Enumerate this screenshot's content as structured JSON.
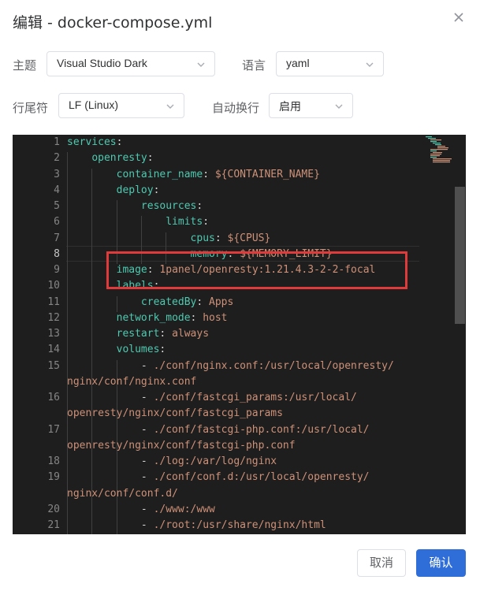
{
  "dialog": {
    "title": "编辑 - docker-compose.yml"
  },
  "form": {
    "theme_label": "主题",
    "theme_value": "Visual Studio Dark",
    "language_label": "语言",
    "language_value": "yaml",
    "eol_label": "行尾符",
    "eol_value": "LF (Linux)",
    "wrap_label": "自动换行",
    "wrap_value": "启用"
  },
  "editor": {
    "current_line": 8,
    "lines": [
      {
        "n": "1",
        "segments": [
          {
            "t": "services",
            "c": "k"
          },
          {
            "t": ":",
            "c": "p"
          }
        ]
      },
      {
        "n": "2",
        "segments": [
          {
            "t": "    "
          },
          {
            "t": "openresty",
            "c": "k"
          },
          {
            "t": ":",
            "c": "p"
          }
        ]
      },
      {
        "n": "3",
        "segments": [
          {
            "t": "        "
          },
          {
            "t": "container_name",
            "c": "k"
          },
          {
            "t": ": ",
            "c": "p"
          },
          {
            "t": "${CONTAINER_NAME}",
            "c": "v"
          }
        ]
      },
      {
        "n": "4",
        "segments": [
          {
            "t": "        "
          },
          {
            "t": "deploy",
            "c": "k"
          },
          {
            "t": ":",
            "c": "p"
          }
        ]
      },
      {
        "n": "5",
        "segments": [
          {
            "t": "            "
          },
          {
            "t": "resources",
            "c": "k"
          },
          {
            "t": ":",
            "c": "p"
          }
        ]
      },
      {
        "n": "6",
        "segments": [
          {
            "t": "                "
          },
          {
            "t": "limits",
            "c": "k"
          },
          {
            "t": ":",
            "c": "p"
          }
        ]
      },
      {
        "n": "7",
        "segments": [
          {
            "t": "                    "
          },
          {
            "t": "cpus",
            "c": "k"
          },
          {
            "t": ": ",
            "c": "p"
          },
          {
            "t": "${CPUS}",
            "c": "v"
          }
        ]
      },
      {
        "n": "8",
        "segments": [
          {
            "t": "                    "
          },
          {
            "t": "memory",
            "c": "k"
          },
          {
            "t": ": ",
            "c": "p"
          },
          {
            "t": "${MEMORY_LIMIT}",
            "c": "v"
          }
        ]
      },
      {
        "n": "9",
        "segments": [
          {
            "t": "        "
          },
          {
            "t": "image",
            "c": "k"
          },
          {
            "t": ": ",
            "c": "p"
          },
          {
            "t": "1panel/openresty:1.21.4.3-2-2-focal",
            "c": "v"
          }
        ]
      },
      {
        "n": "10",
        "segments": [
          {
            "t": "        "
          },
          {
            "t": "labels",
            "c": "k"
          },
          {
            "t": ":",
            "c": "p"
          }
        ]
      },
      {
        "n": "11",
        "segments": [
          {
            "t": "            "
          },
          {
            "t": "createdBy",
            "c": "k"
          },
          {
            "t": ": ",
            "c": "p"
          },
          {
            "t": "Apps",
            "c": "v"
          }
        ]
      },
      {
        "n": "12",
        "segments": [
          {
            "t": "        "
          },
          {
            "t": "network_mode",
            "c": "k"
          },
          {
            "t": ": ",
            "c": "p"
          },
          {
            "t": "host",
            "c": "v"
          }
        ]
      },
      {
        "n": "13",
        "segments": [
          {
            "t": "        "
          },
          {
            "t": "restart",
            "c": "k"
          },
          {
            "t": ": ",
            "c": "p"
          },
          {
            "t": "always",
            "c": "v"
          }
        ]
      },
      {
        "n": "14",
        "segments": [
          {
            "t": "        "
          },
          {
            "t": "volumes",
            "c": "k"
          },
          {
            "t": ":",
            "c": "p"
          }
        ]
      },
      {
        "n": "15",
        "segments": [
          {
            "t": "            "
          },
          {
            "t": "- ",
            "c": "p"
          },
          {
            "t": "./conf/nginx.conf:/usr/local/openresty/",
            "c": "v"
          }
        ]
      },
      {
        "n": "",
        "segments": [
          {
            "t": "nginx/conf/nginx.conf",
            "c": "v"
          }
        ]
      },
      {
        "n": "16",
        "segments": [
          {
            "t": "            "
          },
          {
            "t": "- ",
            "c": "p"
          },
          {
            "t": "./conf/fastcgi_params:/usr/local/",
            "c": "v"
          }
        ]
      },
      {
        "n": "",
        "segments": [
          {
            "t": "openresty/nginx/conf/fastcgi_params",
            "c": "v"
          }
        ]
      },
      {
        "n": "17",
        "segments": [
          {
            "t": "            "
          },
          {
            "t": "- ",
            "c": "p"
          },
          {
            "t": "./conf/fastcgi-php.conf:/usr/local/",
            "c": "v"
          }
        ]
      },
      {
        "n": "",
        "segments": [
          {
            "t": "openresty/nginx/conf/fastcgi-php.conf",
            "c": "v"
          }
        ]
      },
      {
        "n": "18",
        "segments": [
          {
            "t": "            "
          },
          {
            "t": "- ",
            "c": "p"
          },
          {
            "t": "./log:/var/log/nginx",
            "c": "v"
          }
        ]
      },
      {
        "n": "19",
        "segments": [
          {
            "t": "            "
          },
          {
            "t": "- ",
            "c": "p"
          },
          {
            "t": "./conf/conf.d:/usr/local/openresty/",
            "c": "v"
          }
        ]
      },
      {
        "n": "",
        "segments": [
          {
            "t": "nginx/conf/conf.d/",
            "c": "v"
          }
        ]
      },
      {
        "n": "20",
        "segments": [
          {
            "t": "            "
          },
          {
            "t": "- ",
            "c": "p"
          },
          {
            "t": "./www:/www",
            "c": "v"
          }
        ]
      },
      {
        "n": "21",
        "segments": [
          {
            "t": "            "
          },
          {
            "t": "- ",
            "c": "p"
          },
          {
            "t": "./root:/usr/share/nginx/html",
            "c": "v"
          }
        ]
      }
    ]
  },
  "footer": {
    "cancel_label": "取消",
    "confirm_label": "确认"
  },
  "colors": {
    "key": "#4ec9b0",
    "value": "#ce9178",
    "punct": "#d4d4d4",
    "primary": "#2f6ed8",
    "highlight": "#e03a3a",
    "editor_bg": "#1e1e1e"
  }
}
